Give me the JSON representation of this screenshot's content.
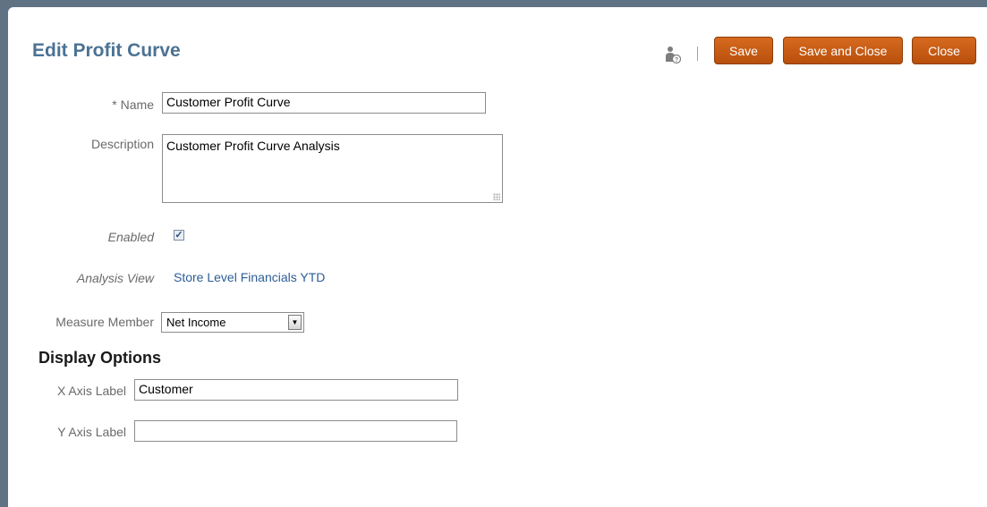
{
  "page": {
    "title": "Edit Profit Curve"
  },
  "toolbar": {
    "help_icon": "user-help-icon",
    "save_label": "Save",
    "save_close_label": "Save and Close",
    "close_label": "Close",
    "button_color": "#c85d14"
  },
  "form": {
    "name": {
      "required_marker": "*",
      "label": "Name",
      "value": "Customer Profit Curve"
    },
    "description": {
      "label": "Description",
      "value": "Customer Profit Curve Analysis"
    },
    "enabled": {
      "label": "Enabled",
      "checked": true,
      "check_glyph": "✓"
    },
    "analysis_view": {
      "label": "Analysis View",
      "value": "Store Level Financials YTD"
    },
    "measure_member": {
      "label": "Measure Member",
      "value": "Net Income",
      "arrow": "▼"
    }
  },
  "display_options": {
    "heading": "Display Options",
    "x_axis": {
      "label": "X Axis Label",
      "value": "Customer"
    },
    "y_axis": {
      "label": "Y Axis Label",
      "value": ""
    }
  }
}
